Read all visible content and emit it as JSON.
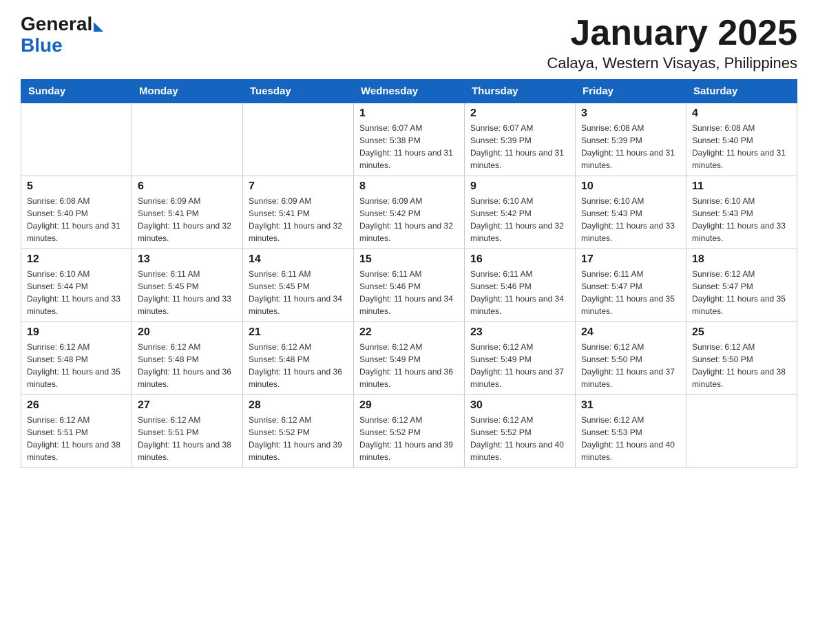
{
  "header": {
    "logo_general": "General",
    "logo_blue": "Blue",
    "month_title": "January 2025",
    "location": "Calaya, Western Visayas, Philippines"
  },
  "days_of_week": [
    "Sunday",
    "Monday",
    "Tuesday",
    "Wednesday",
    "Thursday",
    "Friday",
    "Saturday"
  ],
  "weeks": [
    [
      {
        "day": "",
        "info": ""
      },
      {
        "day": "",
        "info": ""
      },
      {
        "day": "",
        "info": ""
      },
      {
        "day": "1",
        "info": "Sunrise: 6:07 AM\nSunset: 5:38 PM\nDaylight: 11 hours and 31 minutes."
      },
      {
        "day": "2",
        "info": "Sunrise: 6:07 AM\nSunset: 5:39 PM\nDaylight: 11 hours and 31 minutes."
      },
      {
        "day": "3",
        "info": "Sunrise: 6:08 AM\nSunset: 5:39 PM\nDaylight: 11 hours and 31 minutes."
      },
      {
        "day": "4",
        "info": "Sunrise: 6:08 AM\nSunset: 5:40 PM\nDaylight: 11 hours and 31 minutes."
      }
    ],
    [
      {
        "day": "5",
        "info": "Sunrise: 6:08 AM\nSunset: 5:40 PM\nDaylight: 11 hours and 31 minutes."
      },
      {
        "day": "6",
        "info": "Sunrise: 6:09 AM\nSunset: 5:41 PM\nDaylight: 11 hours and 32 minutes."
      },
      {
        "day": "7",
        "info": "Sunrise: 6:09 AM\nSunset: 5:41 PM\nDaylight: 11 hours and 32 minutes."
      },
      {
        "day": "8",
        "info": "Sunrise: 6:09 AM\nSunset: 5:42 PM\nDaylight: 11 hours and 32 minutes."
      },
      {
        "day": "9",
        "info": "Sunrise: 6:10 AM\nSunset: 5:42 PM\nDaylight: 11 hours and 32 minutes."
      },
      {
        "day": "10",
        "info": "Sunrise: 6:10 AM\nSunset: 5:43 PM\nDaylight: 11 hours and 33 minutes."
      },
      {
        "day": "11",
        "info": "Sunrise: 6:10 AM\nSunset: 5:43 PM\nDaylight: 11 hours and 33 minutes."
      }
    ],
    [
      {
        "day": "12",
        "info": "Sunrise: 6:10 AM\nSunset: 5:44 PM\nDaylight: 11 hours and 33 minutes."
      },
      {
        "day": "13",
        "info": "Sunrise: 6:11 AM\nSunset: 5:45 PM\nDaylight: 11 hours and 33 minutes."
      },
      {
        "day": "14",
        "info": "Sunrise: 6:11 AM\nSunset: 5:45 PM\nDaylight: 11 hours and 34 minutes."
      },
      {
        "day": "15",
        "info": "Sunrise: 6:11 AM\nSunset: 5:46 PM\nDaylight: 11 hours and 34 minutes."
      },
      {
        "day": "16",
        "info": "Sunrise: 6:11 AM\nSunset: 5:46 PM\nDaylight: 11 hours and 34 minutes."
      },
      {
        "day": "17",
        "info": "Sunrise: 6:11 AM\nSunset: 5:47 PM\nDaylight: 11 hours and 35 minutes."
      },
      {
        "day": "18",
        "info": "Sunrise: 6:12 AM\nSunset: 5:47 PM\nDaylight: 11 hours and 35 minutes."
      }
    ],
    [
      {
        "day": "19",
        "info": "Sunrise: 6:12 AM\nSunset: 5:48 PM\nDaylight: 11 hours and 35 minutes."
      },
      {
        "day": "20",
        "info": "Sunrise: 6:12 AM\nSunset: 5:48 PM\nDaylight: 11 hours and 36 minutes."
      },
      {
        "day": "21",
        "info": "Sunrise: 6:12 AM\nSunset: 5:48 PM\nDaylight: 11 hours and 36 minutes."
      },
      {
        "day": "22",
        "info": "Sunrise: 6:12 AM\nSunset: 5:49 PM\nDaylight: 11 hours and 36 minutes."
      },
      {
        "day": "23",
        "info": "Sunrise: 6:12 AM\nSunset: 5:49 PM\nDaylight: 11 hours and 37 minutes."
      },
      {
        "day": "24",
        "info": "Sunrise: 6:12 AM\nSunset: 5:50 PM\nDaylight: 11 hours and 37 minutes."
      },
      {
        "day": "25",
        "info": "Sunrise: 6:12 AM\nSunset: 5:50 PM\nDaylight: 11 hours and 38 minutes."
      }
    ],
    [
      {
        "day": "26",
        "info": "Sunrise: 6:12 AM\nSunset: 5:51 PM\nDaylight: 11 hours and 38 minutes."
      },
      {
        "day": "27",
        "info": "Sunrise: 6:12 AM\nSunset: 5:51 PM\nDaylight: 11 hours and 38 minutes."
      },
      {
        "day": "28",
        "info": "Sunrise: 6:12 AM\nSunset: 5:52 PM\nDaylight: 11 hours and 39 minutes."
      },
      {
        "day": "29",
        "info": "Sunrise: 6:12 AM\nSunset: 5:52 PM\nDaylight: 11 hours and 39 minutes."
      },
      {
        "day": "30",
        "info": "Sunrise: 6:12 AM\nSunset: 5:52 PM\nDaylight: 11 hours and 40 minutes."
      },
      {
        "day": "31",
        "info": "Sunrise: 6:12 AM\nSunset: 5:53 PM\nDaylight: 11 hours and 40 minutes."
      },
      {
        "day": "",
        "info": ""
      }
    ]
  ]
}
